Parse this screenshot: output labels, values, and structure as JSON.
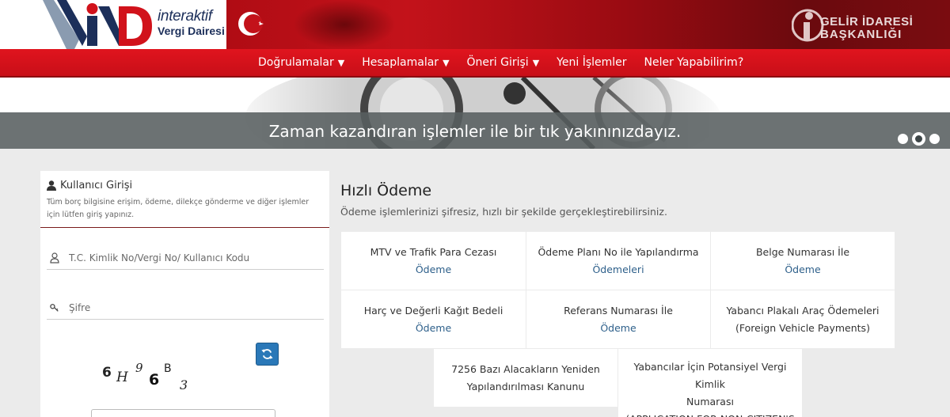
{
  "header": {
    "logo_text_line1": "interaktif",
    "logo_text_line2": "Vergi Dairesi",
    "gib_line1": "GELİR İDARESİ",
    "gib_line2": "BAŞKANLIĞI"
  },
  "nav": {
    "items": [
      {
        "label": "Doğrulamalar",
        "caret": "▼"
      },
      {
        "label": "Hesaplamalar",
        "caret": "▼"
      },
      {
        "label": "Öneri Girişi",
        "caret": "▼"
      },
      {
        "label": "Yeni İşlemler",
        "caret": ""
      },
      {
        "label": "Neler Yapabilirim?",
        "caret": ""
      }
    ]
  },
  "hero": {
    "caption": "Zaman kazandıran işlemler ile bir tık yakınınızdayız."
  },
  "login": {
    "title": "Kullanıcı Girişi",
    "description": "Tüm borç bilgisine erişim, ödeme, dilekçe gönderme ve diğer işlemler için lütfen giriş yapınız.",
    "username_placeholder": "T.C. Kimlik No/Vergi No/ Kullanıcı Kodu",
    "password_placeholder": "Şifre",
    "captcha_chars": [
      "6",
      "H",
      "9",
      "6",
      "B",
      "3"
    ]
  },
  "quick_payment": {
    "title": "Hızlı Ödeme",
    "subtitle": "Ödeme işlemlerinizi şifresiz, hızlı bir şekilde gerçekleştirebilirsiniz.",
    "cells": [
      {
        "line1": "MTV ve Trafik Para Cezası",
        "line2": "Ödeme",
        "link": true
      },
      {
        "line1": "Ödeme Planı No ile Yapılandırma",
        "line2": "Ödemeleri",
        "link": true
      },
      {
        "line1": "Belge Numarası İle",
        "line2": "Ödeme",
        "link": true
      },
      {
        "line1": "Harç ve Değerli Kağıt Bedeli",
        "line2": "Ödeme",
        "link": true
      },
      {
        "line1": "Referans Numarası İle",
        "line2": "Ödeme",
        "link": true
      },
      {
        "line1": "Yabancı Plakalı Araç Ödemeleri",
        "line2": "(Foreign Vehicle Payments)",
        "link": false
      },
      {
        "line1": "7256 Bazı Alacakların Yeniden",
        "line2": "Yapılandırılması Kanunu",
        "link": false
      },
      {
        "line1": "Yabancılar İçin Potansiyel Vergi Kimlik",
        "line2": "Numarası",
        "line3": "(APPLICATION FOR NON-CITIZEN'S",
        "link": false
      }
    ]
  },
  "colors": {
    "nav_red": "#d1121b",
    "link_blue": "#2d5f8a",
    "refresh_blue": "#2a78b8"
  }
}
